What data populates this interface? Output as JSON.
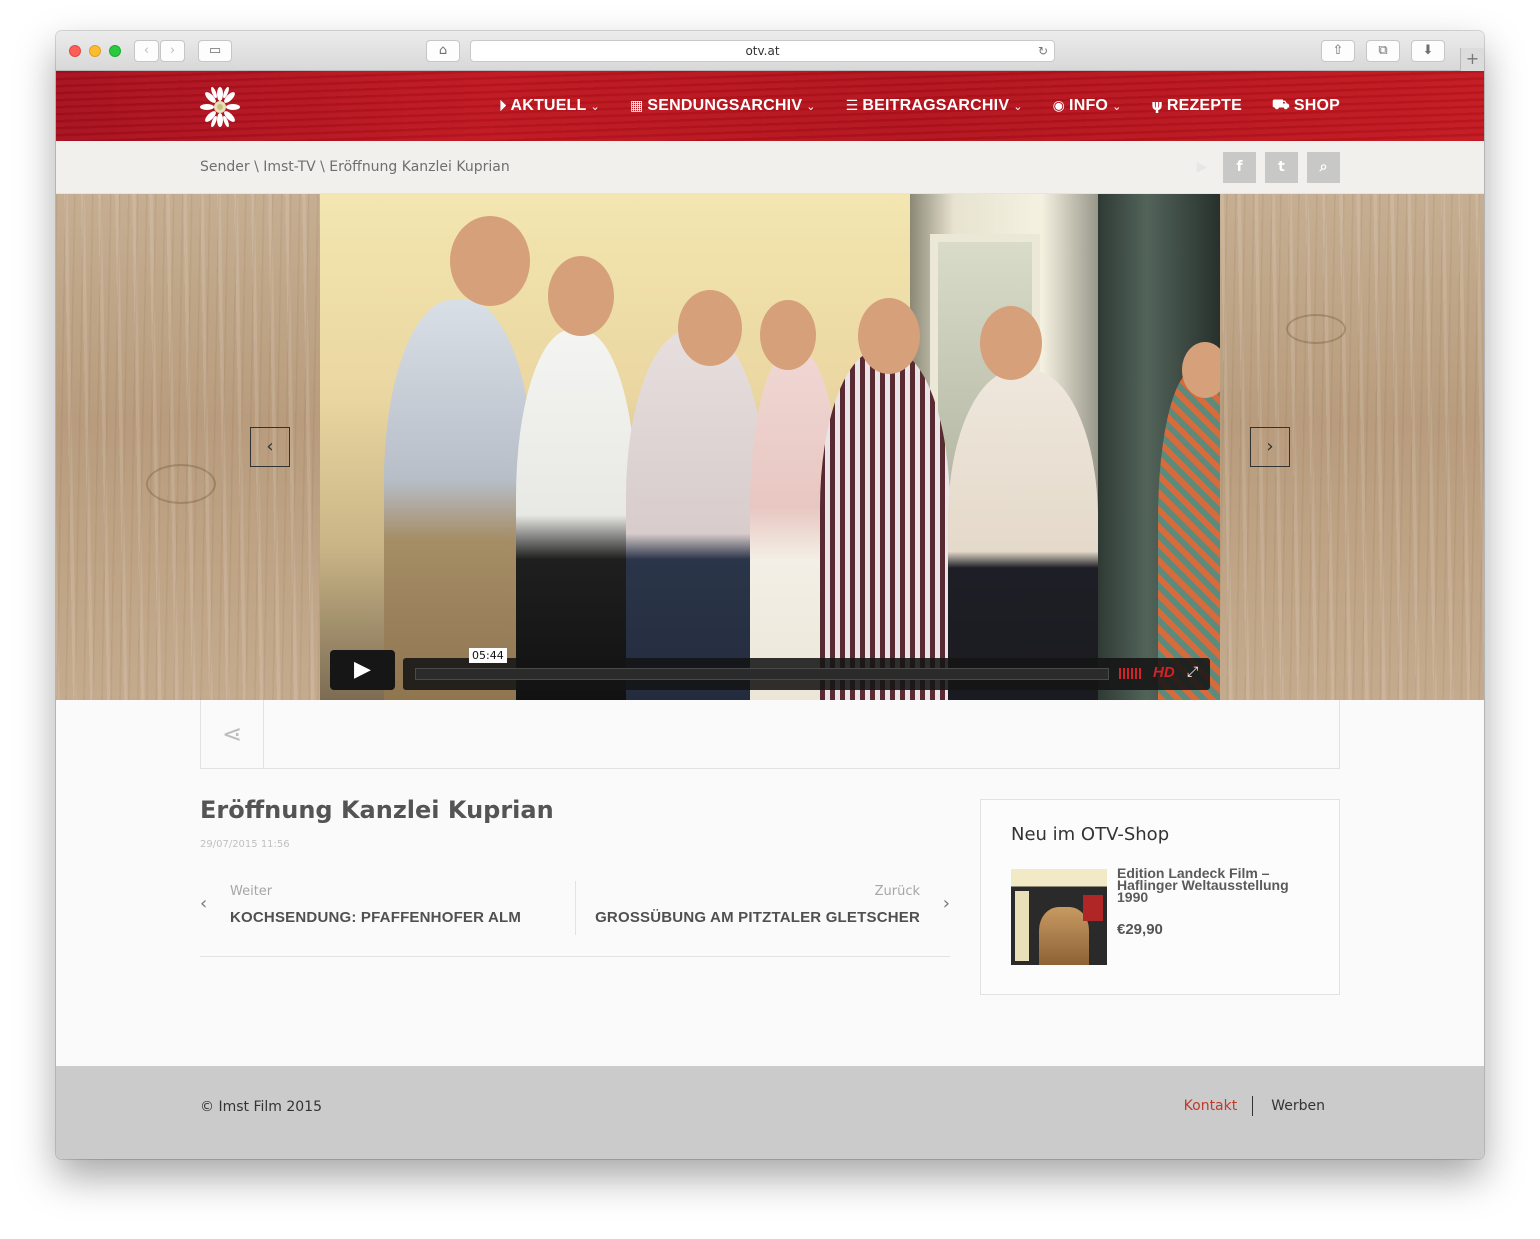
{
  "browser": {
    "url": "otv.at",
    "back_icon": "chevron-left-icon",
    "forward_icon": "chevron-right-icon"
  },
  "header": {
    "nav": [
      {
        "label": "AKTUELL",
        "icon": "play-circle-icon",
        "has_dropdown": true
      },
      {
        "label": "SENDUNGSARCHIV",
        "icon": "grid-icon",
        "has_dropdown": true
      },
      {
        "label": "BEITRAGSARCHIV",
        "icon": "list-icon",
        "has_dropdown": true
      },
      {
        "label": "INFO",
        "icon": "info-circle-icon",
        "has_dropdown": true
      },
      {
        "label": "REZEPTE",
        "icon": "cutlery-icon",
        "has_dropdown": false
      },
      {
        "label": "SHOP",
        "icon": "cart-icon",
        "has_dropdown": false
      }
    ],
    "accent_color": "#b8131d"
  },
  "subbar": {
    "breadcrumb": "Sender \\ Imst-TV \\ Eröffnung Kanzlei Kuprian"
  },
  "video": {
    "timecode": "05:44",
    "hd_label": "HD",
    "progress": 0
  },
  "article": {
    "title": "Eröffnung Kanzlei Kuprian",
    "date": "29/07/2015 11:56",
    "next_small": "Weiter",
    "next_title": "KOCHSENDUNG: PFAFFENHOFER ALM",
    "prev_small": "Zurück",
    "prev_title": "GROSSÜBUNG AM PITZTALER GLETSCHER"
  },
  "sidebar": {
    "widget_title": "Neu im OTV-Shop",
    "product_name": "Edition Landeck Film – Haflinger Weltausstellung 1990",
    "product_price": "€29,90"
  },
  "footer": {
    "copyright": "© Imst Film 2015",
    "link_contact": "Kontakt",
    "link_advertise": "Werben"
  }
}
